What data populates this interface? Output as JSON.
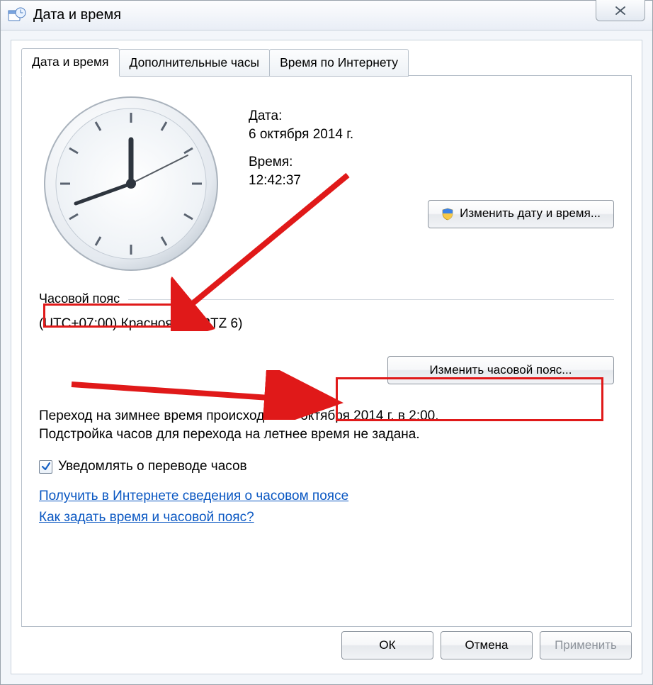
{
  "title": "Дата и время",
  "close_glyph": "✕",
  "tabs": [
    {
      "label": "Дата и время"
    },
    {
      "label": "Дополнительные часы"
    },
    {
      "label": "Время по Интернету"
    }
  ],
  "date": {
    "label": "Дата:",
    "value": "6 октября 2014 г."
  },
  "time": {
    "label": "Время:",
    "value": "12:42:37"
  },
  "btn_change_datetime": "Изменить дату и время...",
  "section_timezone": "Часовой пояс",
  "timezone_value": "(UTC+07:00) Красноярск (RTZ 6)",
  "btn_change_timezone": "Изменить часовой пояс...",
  "dst_text_line1": "Переход на зимнее время происходит 26 октября 2014 г. в 2:00.",
  "dst_text_line2": "Подстройка часов для перехода на летнее время не задана.",
  "checkbox_notify": "Уведомлять о переводе часов",
  "link_info": "Получить в Интернете сведения о часовом поясе",
  "link_how": "Как задать время и часовой пояс?",
  "btn_ok": "ОК",
  "btn_cancel": "Отмена",
  "btn_apply": "Применить"
}
